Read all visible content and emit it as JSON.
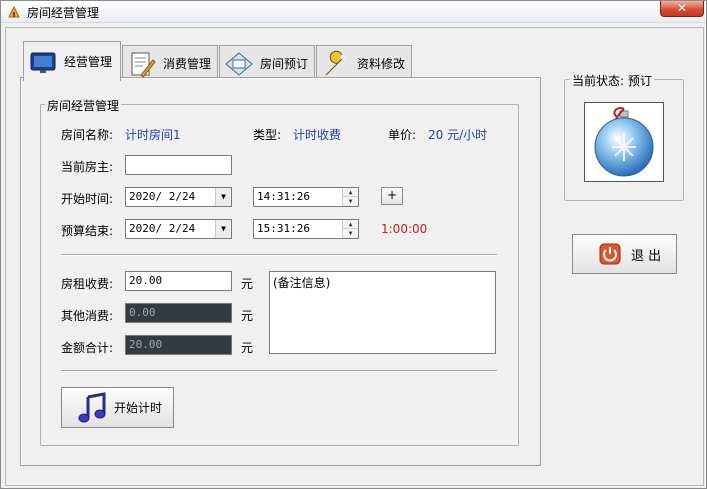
{
  "window": {
    "title": "房间经营管理",
    "close_label": "✕"
  },
  "tabs": [
    {
      "label": "经营管理",
      "icon": "monitor-icon",
      "active": true
    },
    {
      "label": "消费管理",
      "icon": "document-pencil-icon",
      "active": false
    },
    {
      "label": "房间预订",
      "icon": "envelope-icon",
      "active": false
    },
    {
      "label": "资料修改",
      "icon": "wrench-icon",
      "active": false
    }
  ],
  "group": {
    "title": "房间经营管理",
    "room_name_label": "房间名称:",
    "room_name_value": "计时房间1",
    "type_label": "类型:",
    "type_value": "计时收费",
    "price_label": "单价:",
    "price_value": "20 元/小时",
    "owner_label": "当前房主:",
    "owner_value": "",
    "start_label": "开始时间:",
    "start_date": "2020/ 2/24",
    "start_time": "14:31:26",
    "plus_label": "+",
    "end_label": "预算结束:",
    "end_date": "2020/ 2/24",
    "end_time": "15:31:26",
    "duration": "1:00:00",
    "rent_label": "房租收费:",
    "rent_value": "20.00",
    "other_label": "其他消费:",
    "other_value": "0.00",
    "total_label": "金额合计:",
    "total_value": "20.00",
    "unit": "元",
    "memo": "(备注信息)",
    "start_button": "开始计时"
  },
  "status": {
    "title": "当前状态: 预订",
    "image": "ornament-ball-icon"
  },
  "exit_button": "退 出",
  "colors": {
    "value_blue": "#1f3ea8",
    "duration_red": "#c0201a",
    "disabled_field": "#323c40"
  }
}
